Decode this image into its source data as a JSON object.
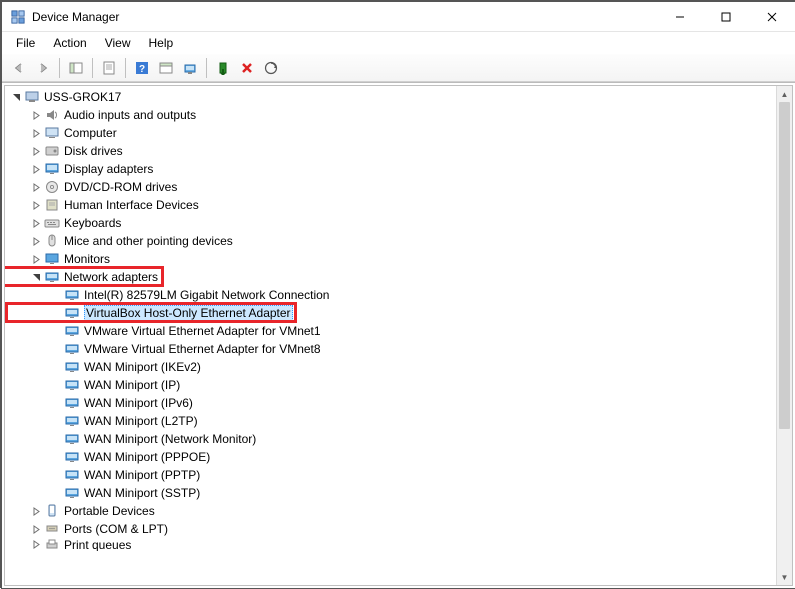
{
  "window": {
    "title": "Device Manager"
  },
  "menu": {
    "file": "File",
    "action": "Action",
    "view": "View",
    "help": "Help"
  },
  "tree": {
    "root": "USS-GROK17",
    "categories": [
      {
        "label": "Audio inputs and outputs",
        "expanded": false,
        "icon": "audio"
      },
      {
        "label": "Computer",
        "expanded": false,
        "icon": "computer"
      },
      {
        "label": "Disk drives",
        "expanded": false,
        "icon": "disk"
      },
      {
        "label": "Display adapters",
        "expanded": false,
        "icon": "display"
      },
      {
        "label": "DVD/CD-ROM drives",
        "expanded": false,
        "icon": "dvd"
      },
      {
        "label": "Human Interface Devices",
        "expanded": false,
        "icon": "hid"
      },
      {
        "label": "Keyboards",
        "expanded": false,
        "icon": "keyboard"
      },
      {
        "label": "Mice and other pointing devices",
        "expanded": false,
        "icon": "mouse"
      },
      {
        "label": "Monitors",
        "expanded": false,
        "icon": "monitor"
      },
      {
        "label": "Network adapters",
        "expanded": true,
        "icon": "network",
        "highlight_category": true,
        "children": [
          {
            "label": "Intel(R) 82579LM Gigabit Network Connection"
          },
          {
            "label": "VirtualBox Host-Only Ethernet Adapter",
            "selected": true,
            "highlight_item": true
          },
          {
            "label": "VMware Virtual Ethernet Adapter for VMnet1"
          },
          {
            "label": "VMware Virtual Ethernet Adapter for VMnet8"
          },
          {
            "label": "WAN Miniport (IKEv2)"
          },
          {
            "label": "WAN Miniport (IP)"
          },
          {
            "label": "WAN Miniport (IPv6)"
          },
          {
            "label": "WAN Miniport (L2TP)"
          },
          {
            "label": "WAN Miniport (Network Monitor)"
          },
          {
            "label": "WAN Miniport (PPPOE)"
          },
          {
            "label": "WAN Miniport (PPTP)"
          },
          {
            "label": "WAN Miniport (SSTP)"
          }
        ]
      },
      {
        "label": "Portable Devices",
        "expanded": false,
        "icon": "portable"
      },
      {
        "label": "Ports (COM & LPT)",
        "expanded": false,
        "icon": "ports"
      },
      {
        "label": "Print queues",
        "expanded": false,
        "icon": "print",
        "clipped": true
      }
    ]
  },
  "colors": {
    "highlight_border": "#e8252a",
    "selection_bg": "#cce8ff"
  }
}
